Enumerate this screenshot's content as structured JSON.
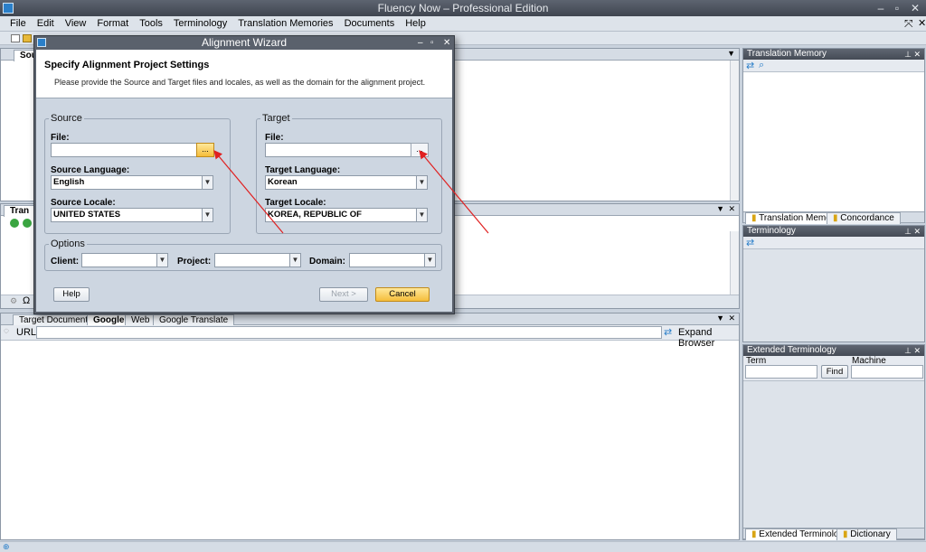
{
  "window": {
    "title": "Fluency Now – Professional Edition",
    "min": "–",
    "restore": "▫",
    "close": "✕"
  },
  "menu": [
    "File",
    "Edit",
    "View",
    "Format",
    "Tools",
    "Terminology",
    "Translation Memories",
    "Documents",
    "Help"
  ],
  "source_panel": {
    "tab": "Sour"
  },
  "trans_panel": {
    "tab": "Tran",
    "omega": "Ω"
  },
  "browser_panel": {
    "tabs": [
      "Target Document",
      "Google",
      "Web",
      "Google Translate"
    ],
    "url_label": "URL:",
    "url_value": "",
    "expand": "Expand Browser"
  },
  "tm_panel": {
    "title": "Translation Memory",
    "tabs": [
      "Translation Memory",
      "Concordance"
    ]
  },
  "terminology_panel": {
    "title": "Terminology"
  },
  "ext_panel": {
    "title": "Extended Terminology",
    "term_label": "Term",
    "machine_label": "Machine",
    "find": "Find",
    "tabs": [
      "Extended Terminology",
      "Dictionary"
    ]
  },
  "dialog": {
    "title": "Alignment Wizard",
    "heading": "Specify Alignment Project Settings",
    "description": "Please provide the Source and Target files and locales, as well as the domain for the alignment project.",
    "source": {
      "legend": "Source",
      "file_label": "File:",
      "file_value": "",
      "language_label": "Source Language:",
      "language": "English",
      "locale_label": "Source Locale:",
      "locale": "UNITED STATES"
    },
    "target": {
      "legend": "Target",
      "file_label": "File:",
      "file_value": "",
      "language_label": "Target Language:",
      "language": "Korean",
      "locale_label": "Target Locale:",
      "locale": "KOREA, REPUBLIC OF"
    },
    "options": {
      "legend": "Options",
      "client_label": "Client:",
      "project_label": "Project:",
      "domain_label": "Domain:"
    },
    "browse": "...",
    "help": "Help",
    "next": "Next >",
    "cancel": "Cancel"
  },
  "colors": {
    "annotation_arrow": "#e02020",
    "highlight": "#f5bd3b"
  }
}
